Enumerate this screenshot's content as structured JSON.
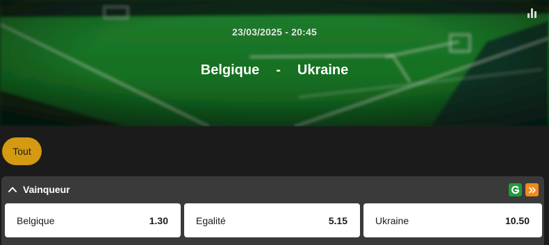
{
  "event": {
    "datetime": "23/03/2025 - 20:45",
    "home_team": "Belgique",
    "separator": "-",
    "away_team": "Ukraine"
  },
  "icons": {
    "stats": "bar-chart-icon",
    "collapse": "chevron-up-icon",
    "cashout": "g-logo-icon",
    "boost": "double-chevron-right-icon"
  },
  "filters": {
    "active_label": "Tout"
  },
  "market": {
    "title": "Vainqueur",
    "outcomes": [
      {
        "label": "Belgique",
        "odds": "1.30"
      },
      {
        "label": "Egalité",
        "odds": "5.15"
      },
      {
        "label": "Ukraine",
        "odds": "10.50"
      }
    ]
  },
  "colors": {
    "background": "#1b1b1b",
    "filter_active": "#d39a12",
    "market_bg": "#3a3a3a",
    "badge_green": "#1f9c3a",
    "badge_orange": "#f08a1c",
    "pitch_green": "#1f7a2c"
  }
}
